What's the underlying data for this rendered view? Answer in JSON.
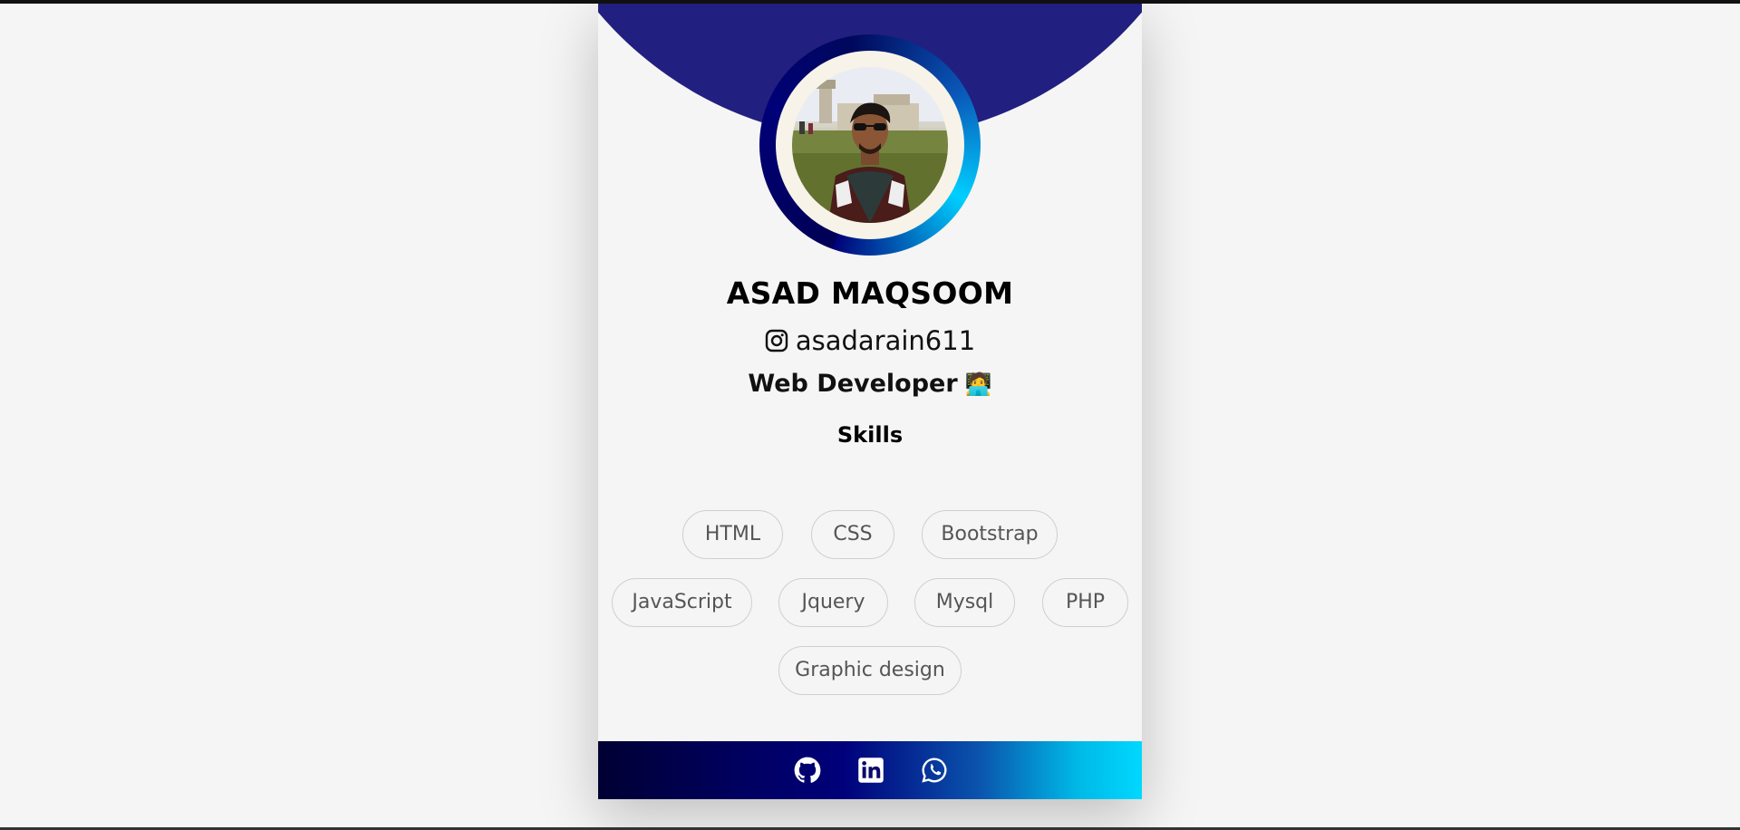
{
  "profile": {
    "name": "ASAD MAQSOOM",
    "instagram_handle": "asadarain611",
    "role": "Web Developer",
    "role_emoji": "🧑‍💻"
  },
  "skills": {
    "title": "Skills",
    "items": [
      "HTML",
      "CSS",
      "Bootstrap",
      "JavaScript",
      "Jquery",
      "Mysql",
      "PHP",
      "Graphic design"
    ]
  },
  "footer": {
    "icons": [
      "github-icon",
      "linkedin-icon",
      "whatsapp-icon"
    ]
  },
  "colors": {
    "page_background": "#f5f5f5",
    "header_arc": "#211f80",
    "footer_gradient_start": "#000033",
    "footer_gradient_end": "#00d8ff"
  }
}
